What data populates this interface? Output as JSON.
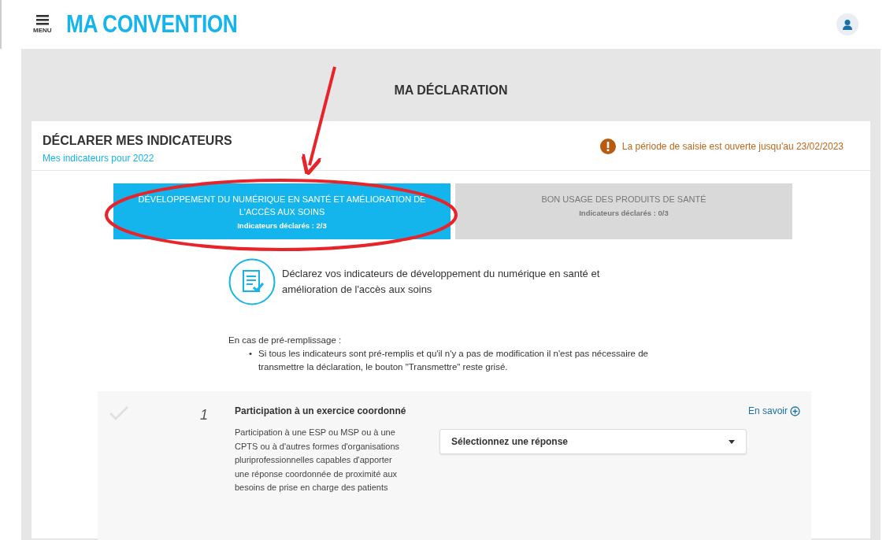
{
  "header": {
    "menu_label": "MENU",
    "title": "MA CONVENTION"
  },
  "page_title": "MA DÉCLARATION",
  "section": {
    "title": "DÉCLARER MES INDICATEURS",
    "subtitle": "Mes indicateurs pour 2022",
    "notice": "La période de saisie est ouverte jusqu'au 23/02/2023"
  },
  "tabs": [
    {
      "label": "DÉVELOPPEMENT DU NUMÉRIQUE EN SANTÉ ET AMÉLIORATION DE L'ACCÈS AUX SOINS",
      "count": "Indicateurs déclarés : 2/3",
      "selected": true
    },
    {
      "label": "BON USAGE DES PRODUITS DE SANTÉ",
      "count": "Indicateurs déclarés : 0/3",
      "selected": false
    }
  ],
  "intro": "Déclarez vos indicateurs de développement du numérique en santé et amélioration de l'accès aux soins",
  "prefill": {
    "heading": "En cas de pré-remplissage :",
    "marker": "•",
    "bullets": [
      "Si tous les indicateurs sont pré-remplis et qu'il n'y a pas de modification il n'est pas nécessaire de transmettre la déclaration, le bouton \"Transmettre\" reste grisé."
    ]
  },
  "indicators": [
    {
      "number": "1",
      "title": "Participation à un exercice coordonné",
      "description": "Participation à une ESP ou MSP ou à une CPTS ou à d'autres formes d'organisations pluriprofessionnelles capables d'apporter une réponse coordonnée de proximité aux besoins de prise en charge des patients",
      "link": "En savoir",
      "select_placeholder": "Sélectionnez une réponse",
      "validated": false
    }
  ]
}
